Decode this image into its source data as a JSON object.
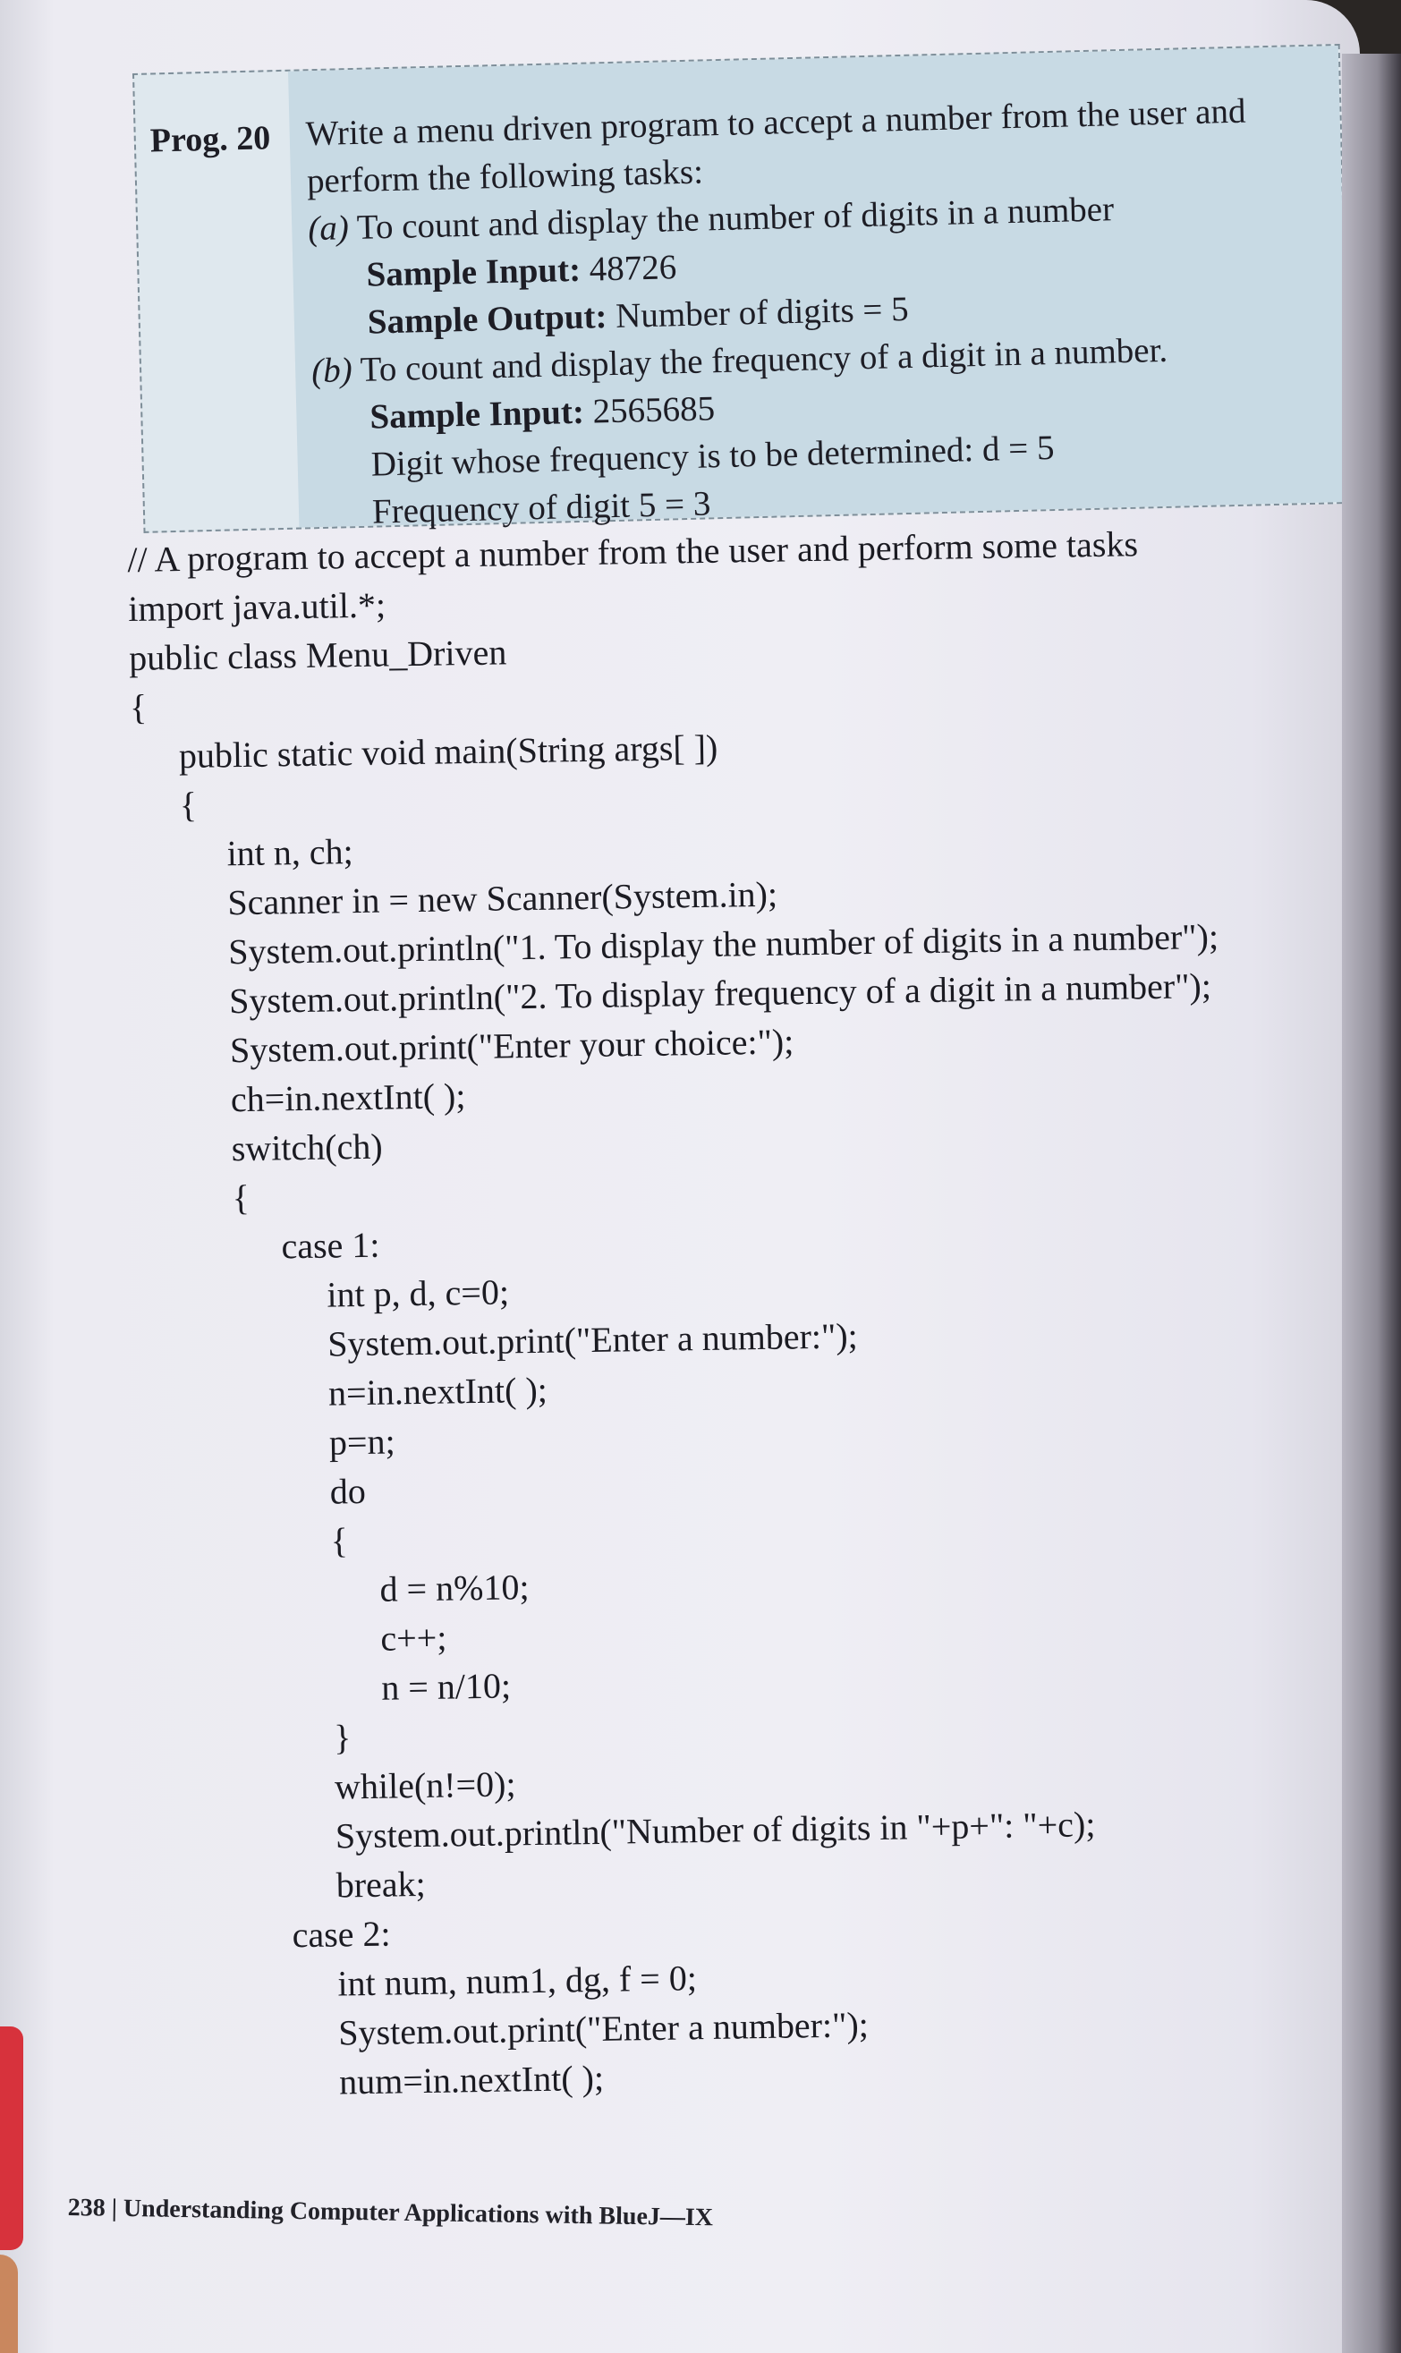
{
  "problem": {
    "label": "Prog. 20",
    "intro_line1": "Write a menu driven program to accept a number from the user and",
    "intro_line2": "perform the following tasks:",
    "part_a": {
      "marker": "(a)",
      "text": "To count and display the number of digits in a number",
      "input_label": "Sample Input:",
      "input_value": "48726",
      "output_label": "Sample Output:",
      "output_value": "Number of digits = 5"
    },
    "part_b": {
      "marker": "(b)",
      "text": "To count and display the frequency of a digit in a number.",
      "input_label": "Sample Input:",
      "input_value": "2565685",
      "line2": "Digit whose frequency is to be determined: d = 5",
      "line3": "Frequency of digit 5 = 3"
    }
  },
  "code_lines": [
    "// A program to accept a number from the user and perform some tasks",
    "import java.util.*;",
    "public class Menu_Driven",
    "{",
    "public static void main(String args[ ])",
    "{",
    "int n, ch;",
    "Scanner in = new Scanner(System.in);",
    "System.out.println(\"1. To display the number of digits in a number\");",
    "System.out.println(\"2. To display frequency of a digit in a number\");",
    "System.out.print(\"Enter your choice:\");",
    "ch=in.nextInt( );",
    "switch(ch)",
    "{",
    "case 1:",
    "int p, d, c=0;",
    "System.out.print(\"Enter a number:\");",
    "n=in.nextInt( );",
    "p=n;",
    "do",
    "{",
    "d = n%10;",
    "c++;",
    "n = n/10;",
    "}",
    "while(n!=0);",
    "System.out.println(\"Number of digits in \"+p+\": \"+c);",
    "break;",
    "case 2:",
    "int num, num1, dg, f = 0;",
    "System.out.print(\"Enter a number:\");",
    "num=in.nextInt( );"
  ],
  "footer": "238 | Understanding Computer Applications with BlueJ—IX"
}
